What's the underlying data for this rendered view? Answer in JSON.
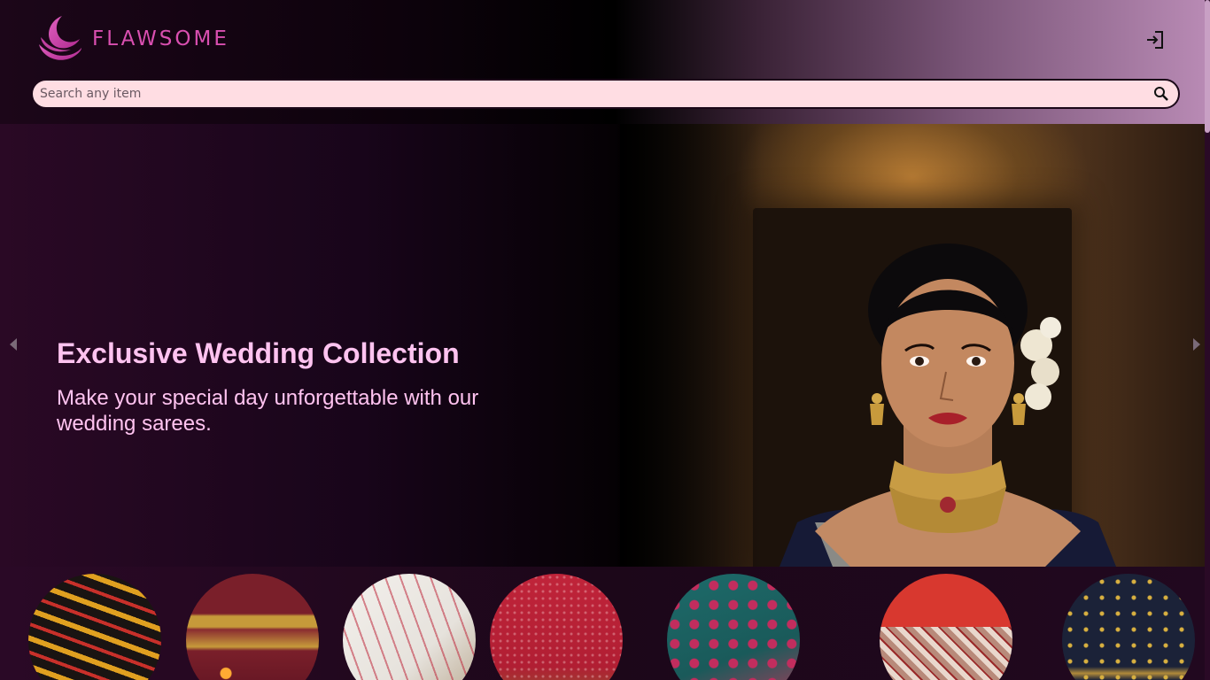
{
  "header": {
    "brand": "FLAWSOME",
    "login_icon": "login-icon"
  },
  "search": {
    "placeholder": "Search any item",
    "icon": "search-icon"
  },
  "hero": {
    "title": "Exclusive Wedding Collection",
    "subtitle": "Make your special day unforgettable with our wedding sarees.",
    "prev_icon": "chevron-left-icon",
    "next_icon": "chevron-right-icon"
  },
  "categories": {
    "items": [
      "saree-1",
      "saree-2",
      "saree-3",
      "saree-4",
      "saree-5",
      "saree-6",
      "saree-7"
    ]
  },
  "colors": {
    "brand": "#d94fb0",
    "hero_text": "#ffc3f0",
    "search_bg": "#ffdde3",
    "background": "#1a0718"
  }
}
